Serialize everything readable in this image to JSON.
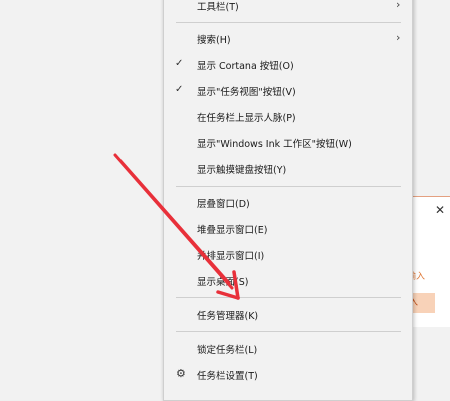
{
  "menu": {
    "items": [
      {
        "label": "工具栏(T)",
        "has_submenu": true
      },
      {
        "label": "搜索(H)",
        "has_submenu": true
      },
      {
        "label": "显示 Cortana 按钮(O)",
        "checked": true
      },
      {
        "label": "显示\"任务视图\"按钮(V)",
        "checked": true
      },
      {
        "label": "在任务栏上显示人脉(P)"
      },
      {
        "label": "显示\"Windows Ink 工作区\"按钮(W)"
      },
      {
        "label": "显示触摸键盘按钮(Y)"
      },
      {
        "label": "层叠窗口(D)"
      },
      {
        "label": "堆叠显示窗口(E)"
      },
      {
        "label": "并排显示窗口(I)"
      },
      {
        "label": "显示桌面(S)"
      },
      {
        "label": "任务管理器(K)"
      },
      {
        "label": "锁定任务栏(L)"
      },
      {
        "label": "任务栏设置(T)"
      }
    ],
    "icons": {
      "check": "check-icon",
      "submenu": "chevron-right-icon",
      "settings": "gear-icon"
    }
  },
  "background_window": {
    "close_glyph": "✕",
    "hint_fragment": "输入",
    "button_fragment": "入"
  },
  "colors": {
    "annotation_arrow": "#e8303a",
    "accent_orange": "#e07a3a"
  }
}
